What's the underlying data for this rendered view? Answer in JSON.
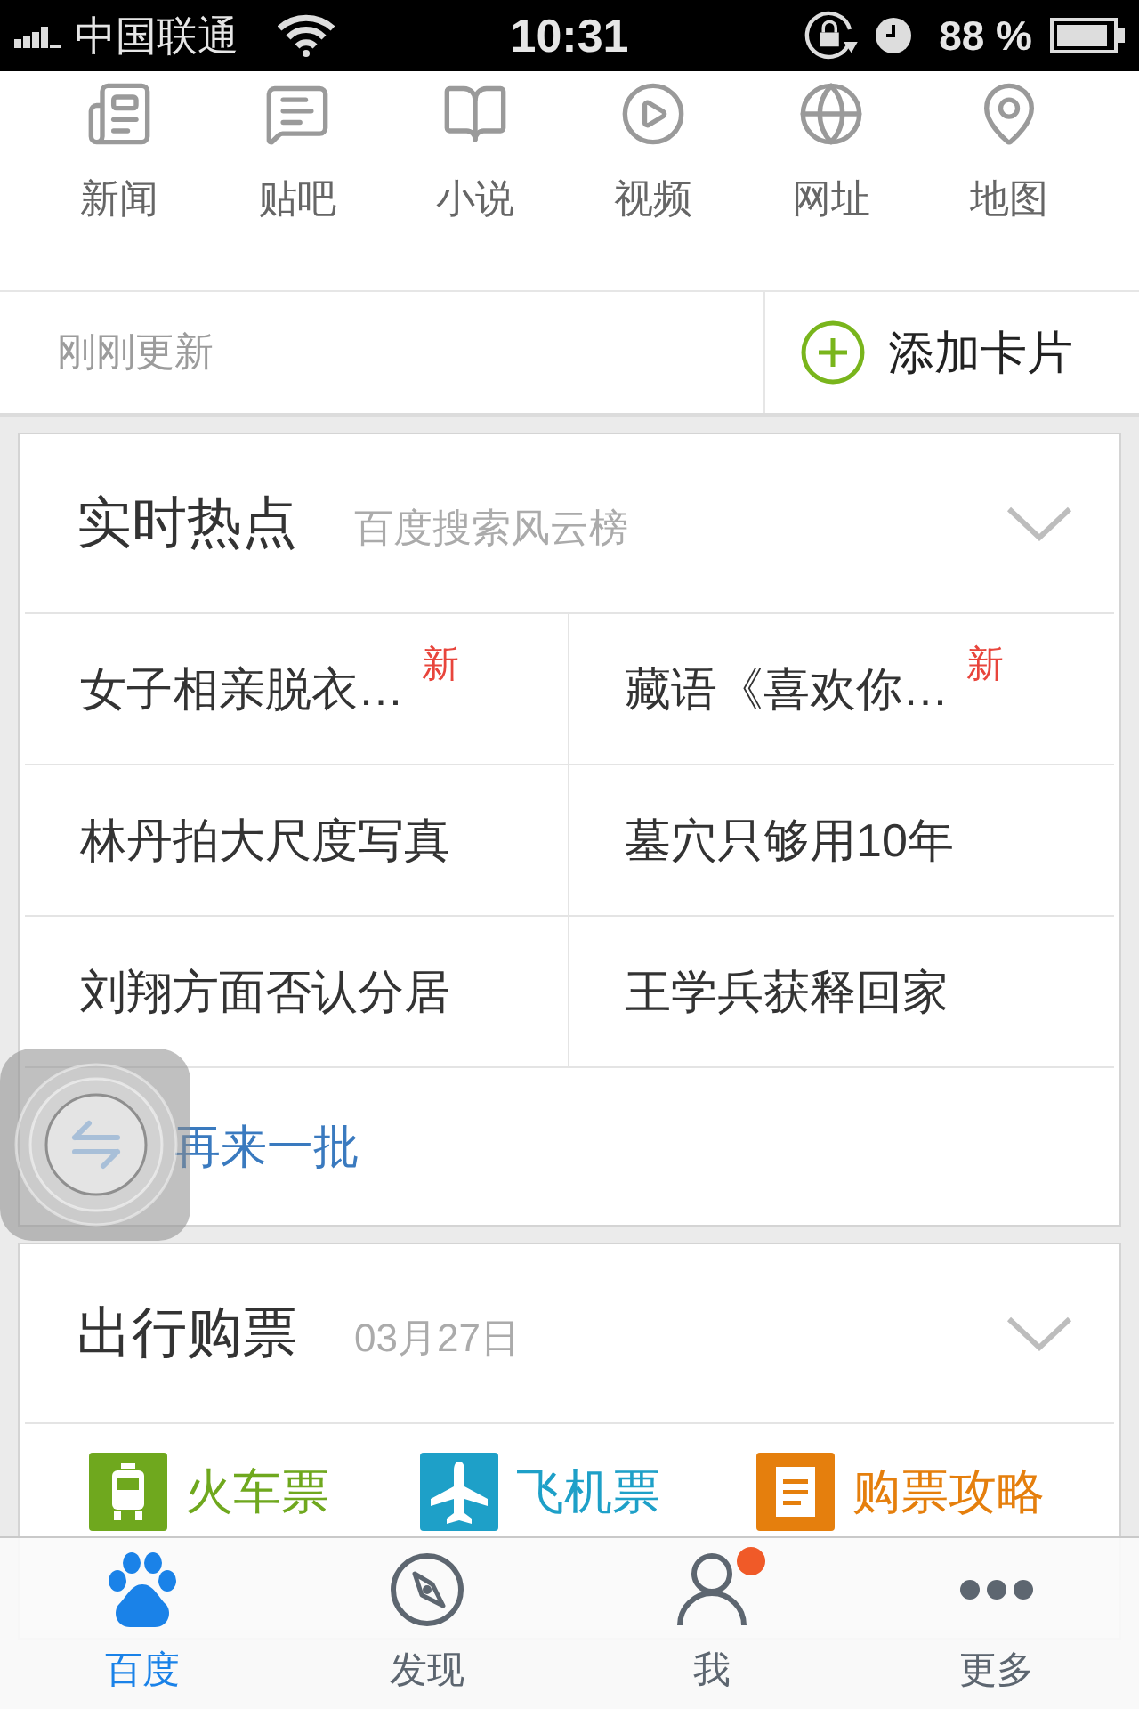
{
  "status_bar": {
    "carrier": "中国联通",
    "time": "10:31",
    "battery": "88 %"
  },
  "quick_nav": [
    {
      "kind": "news",
      "label": "新闻"
    },
    {
      "kind": "forum",
      "label": "贴吧"
    },
    {
      "kind": "novel",
      "label": "小说"
    },
    {
      "kind": "video",
      "label": "视频"
    },
    {
      "kind": "web",
      "label": "网址"
    },
    {
      "kind": "map",
      "label": "地图"
    }
  ],
  "update_bar": {
    "status": "刚刚更新",
    "add_button": "添加卡片"
  },
  "hot_card": {
    "title": "实时热点",
    "subtitle": "百度搜索风云榜",
    "topics": [
      {
        "text": "女子相亲脱衣…",
        "badge": "新"
      },
      {
        "text": "藏语《喜欢你…",
        "badge": "新"
      },
      {
        "text": "林丹拍大尺度写真"
      },
      {
        "text": "墓穴只够用10年"
      },
      {
        "text": "刘翔方面否认分居"
      },
      {
        "text": "王学兵获释回家"
      }
    ],
    "refresh": "再来一批"
  },
  "travel_card": {
    "title": "出行购票",
    "date": "03月27日",
    "shortcuts": [
      {
        "kind": "train",
        "label": "火车票",
        "color": "#6fa81e"
      },
      {
        "kind": "plane",
        "label": "飞机票",
        "color": "#1ea0c8"
      },
      {
        "kind": "guide",
        "label": "购票攻略",
        "color": "#e57f0d"
      }
    ]
  },
  "tab_bar": [
    {
      "kind": "paw",
      "label": "百度",
      "selected": true,
      "notification": false
    },
    {
      "kind": "compass",
      "label": "发现",
      "selected": false,
      "notification": false
    },
    {
      "kind": "person",
      "label": "我",
      "selected": false,
      "notification": true
    },
    {
      "kind": "more",
      "label": "更多",
      "selected": false,
      "notification": false
    }
  ]
}
